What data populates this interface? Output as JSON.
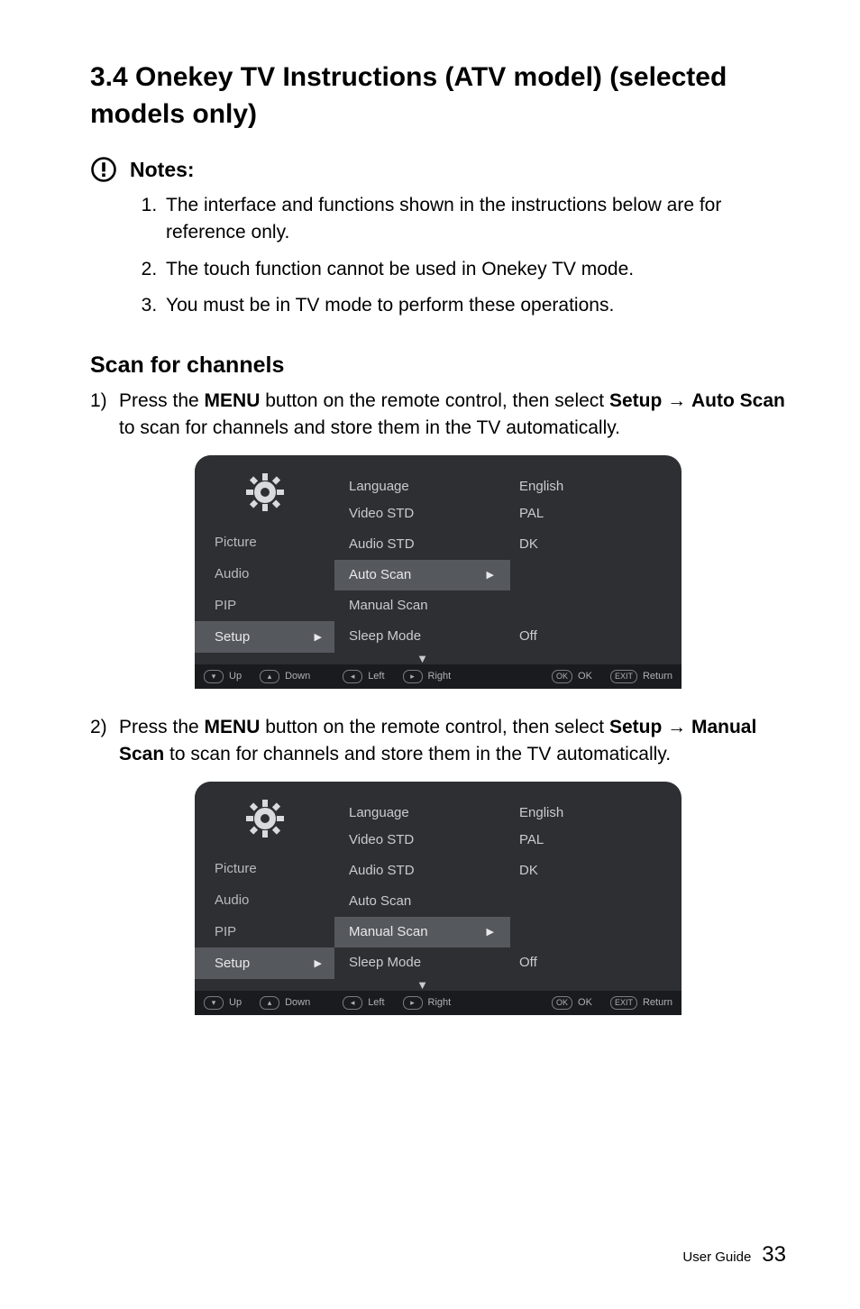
{
  "section_title": "3.4 Onekey TV Instructions (ATV model) (selected models only)",
  "notes_label": "Notes:",
  "notes": [
    "The interface and functions shown in the instructions below are for reference only.",
    "The touch function cannot be used in Onekey TV mode.",
    "You must be in TV mode to perform these operations."
  ],
  "subheading": "Scan for channels",
  "steps": [
    {
      "num": "1)",
      "pre": "Press the ",
      "b1": "MENU",
      "mid1": " button on the remote control, then select ",
      "b2": "Setup",
      "arrow": " → ",
      "b3": "Auto Scan",
      "post": " to scan for channels and store them in the TV automatically."
    },
    {
      "num": "2)",
      "pre": "Press the ",
      "b1": "MENU",
      "mid1": " button on the remote control, then select ",
      "b2": "Setup",
      "arrow": " → ",
      "b3": "Manual Scan",
      "post": " to scan for channels and store them in the TV automatically."
    }
  ],
  "tv": {
    "side": [
      "Picture",
      "Audio",
      "PIP",
      "Setup"
    ],
    "labels": [
      "Language",
      "Video STD",
      "Audio STD",
      "Auto Scan",
      "Manual Scan",
      "Sleep Mode"
    ],
    "values": [
      "English",
      "PAL",
      "DK",
      "",
      "",
      "Off"
    ],
    "footer": {
      "up": "Up",
      "down": "Down",
      "left": "Left",
      "right": "Right",
      "ok": "OK",
      "ret": "Return"
    }
  },
  "footer": {
    "label": "User Guide",
    "page": "33"
  }
}
